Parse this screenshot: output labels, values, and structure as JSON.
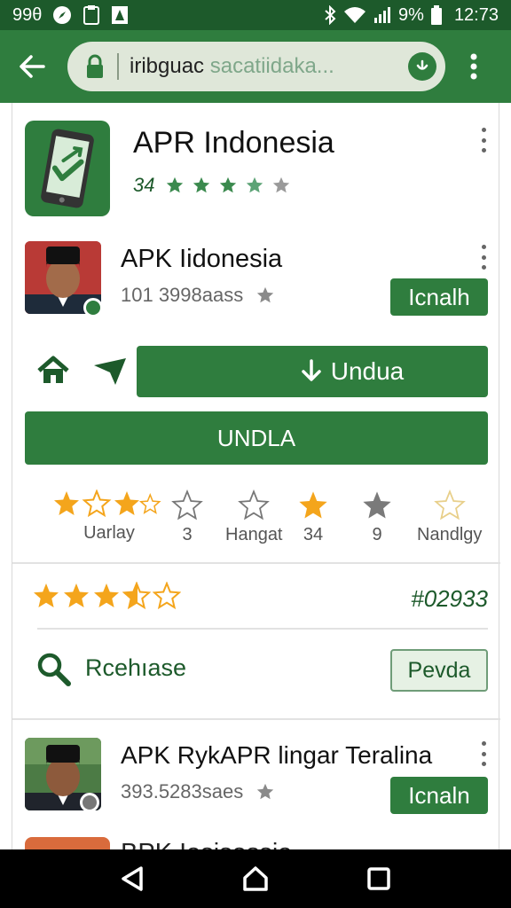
{
  "status_bar": {
    "left_text": "99θ",
    "battery_percent": "9%",
    "time": "12:73"
  },
  "browser": {
    "url_main": "iribguac",
    "url_faded": "sacatiidaka...",
    "icons": [
      "back-arrow-icon",
      "lock-icon",
      "shield-badge-icon",
      "more-vert-icon"
    ]
  },
  "featured_app": {
    "title": "APR Indonesia",
    "rating_number": "34",
    "stars_filled": 4,
    "stars_total": 5
  },
  "app_item_1": {
    "title": "APK Iidonesia",
    "downloads": "101 3998aass",
    "install_label": "Icnalh"
  },
  "actions": {
    "download_label": "Undua",
    "undla_label": "UNDLA"
  },
  "rating_row": [
    {
      "label": "Uarlay",
      "stars": 3
    },
    {
      "label": "3",
      "stars": 1,
      "type": "empty"
    },
    {
      "label": "Hangat",
      "stars": 1,
      "type": "empty"
    },
    {
      "label": "34",
      "stars": 1,
      "type": "gold"
    },
    {
      "label": "9",
      "stars": 1,
      "type": "gray"
    },
    {
      "label": "Nandlgy",
      "stars": 1,
      "type": "pale"
    }
  ],
  "summary": {
    "stars_filled": 3.5,
    "hash_count": "#02933"
  },
  "search_row": {
    "label": "Rcehıase",
    "button_label": "Pevda"
  },
  "app_item_2": {
    "title": "APK RykAPR lingar Teralina",
    "downloads": "393.5283saes",
    "install_label": "Icnaln"
  },
  "peek_item": {
    "title": "BPK Iasisassia"
  },
  "colors": {
    "status_bar": "#1d5a2b",
    "app_bar": "#2f7d3e",
    "primary_green": "#2f7d3e",
    "star_gold": "#f4a51c"
  }
}
